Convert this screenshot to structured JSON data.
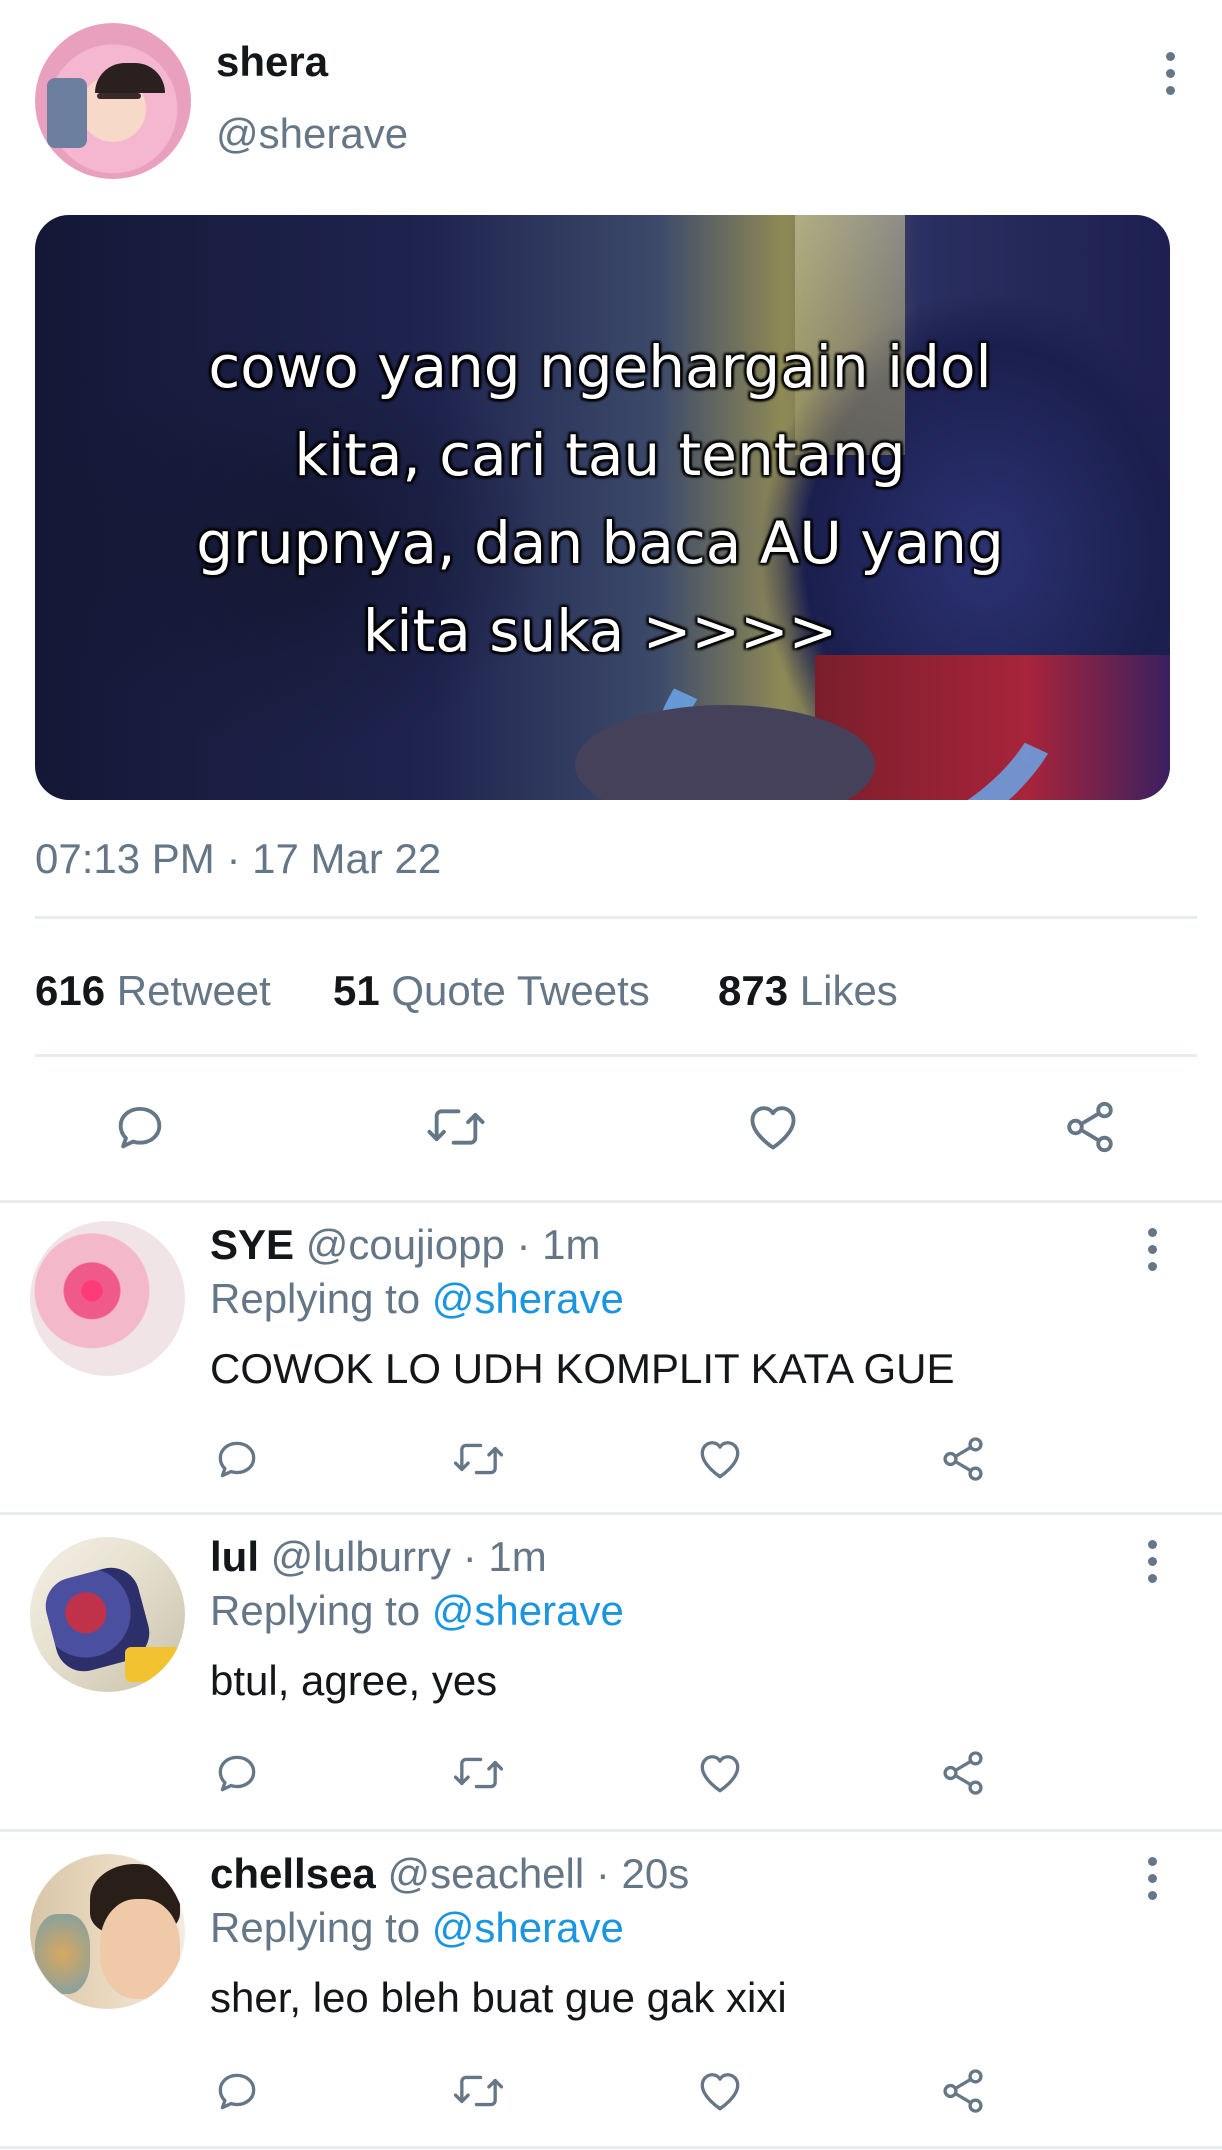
{
  "tweet": {
    "name": "shera",
    "handle": "@sherave",
    "image_caption": "cowo yang ngehargain idol kita, cari tau tentang grupnya, dan baca AU yang kita suka >>>>",
    "timestamp": "07:13 PM · 17 Mar 22",
    "stats": {
      "retweets_count": "616",
      "retweets_label": "Retweet",
      "quotes_count": "51",
      "quotes_label": "Quote Tweets",
      "likes_count": "873",
      "likes_label": "Likes"
    }
  },
  "replies": [
    {
      "name": "SYE",
      "handle": "@coujiopp",
      "time": "· 1m",
      "replying_label": "Replying to",
      "replying_to": "@sherave",
      "text": "COWOK LO UDH KOMPLIT KATA GUE"
    },
    {
      "name": "lul",
      "handle": "@lulburry",
      "time": "· 1m",
      "replying_label": "Replying to",
      "replying_to": "@sherave",
      "text": "btul, agree, yes"
    },
    {
      "name": "chellsea",
      "handle": "@seachell",
      "time": "· 20s",
      "replying_label": "Replying to",
      "replying_to": "@sherave",
      "text": "sher, leo bleh buat gue gak xixi"
    }
  ],
  "colors": {
    "text_primary": "#14171a",
    "text_secondary": "#657786",
    "link": "#1b95e0",
    "divider": "#e6ecf0"
  },
  "icons": [
    "reply-icon",
    "retweet-icon",
    "like-icon",
    "share-icon",
    "more-options-icon"
  ]
}
